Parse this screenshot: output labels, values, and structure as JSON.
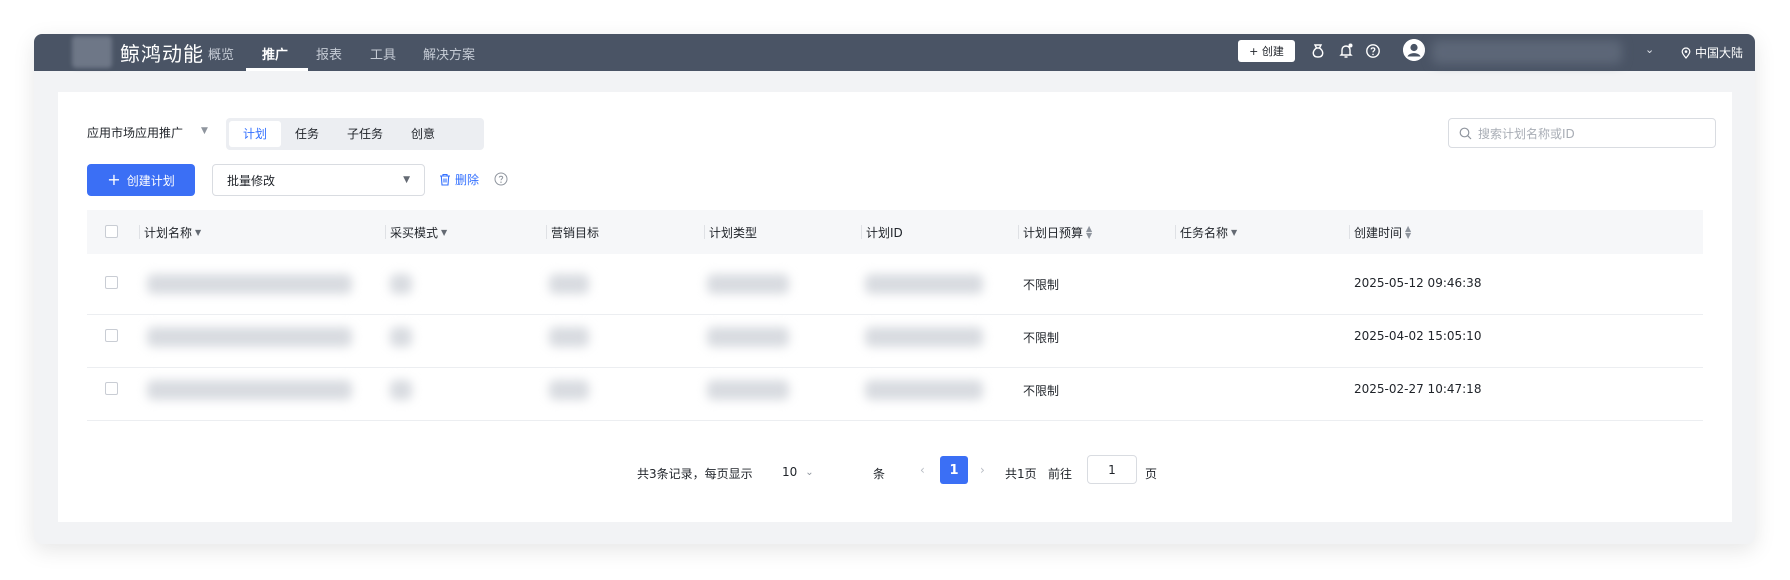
{
  "app": {
    "brand": "鲸鸿动能",
    "nav": [
      "概览",
      "推广",
      "报表",
      "工具",
      "解决方案"
    ],
    "active_nav": "推广",
    "create_label": "+ 创建",
    "region": "中国大陆"
  },
  "toolbar": {
    "scene_select": "应用市场应用推广",
    "tabs": [
      "计划",
      "任务",
      "子任务",
      "创意"
    ],
    "active_tab": "计划",
    "search_placeholder": "搜索计划名称或ID",
    "create_plan": "创建计划",
    "batch_edit": "批量修改",
    "delete": "删除"
  },
  "table": {
    "columns": [
      "计划名称",
      "采买模式",
      "营销目标",
      "计划类型",
      "计划ID",
      "计划日预算",
      "任务名称",
      "创建时间"
    ],
    "rows": [
      {
        "budget": "不限制",
        "created": "2025-05-12 09:46:38"
      },
      {
        "budget": "不限制",
        "created": "2025-04-02 15:05:10"
      },
      {
        "budget": "不限制",
        "created": "2025-02-27 10:47:18"
      }
    ]
  },
  "pagination": {
    "summary": "共3条记录，每页显示",
    "page_size": "10",
    "unit": "条",
    "current_page": "1",
    "total_pages": "共1页",
    "goto_label": "前往",
    "goto_value": "1",
    "page_suffix": "页"
  },
  "colors": {
    "topbar": "#4a5465",
    "accent": "#3b6ff5",
    "link": "#3370ff"
  }
}
